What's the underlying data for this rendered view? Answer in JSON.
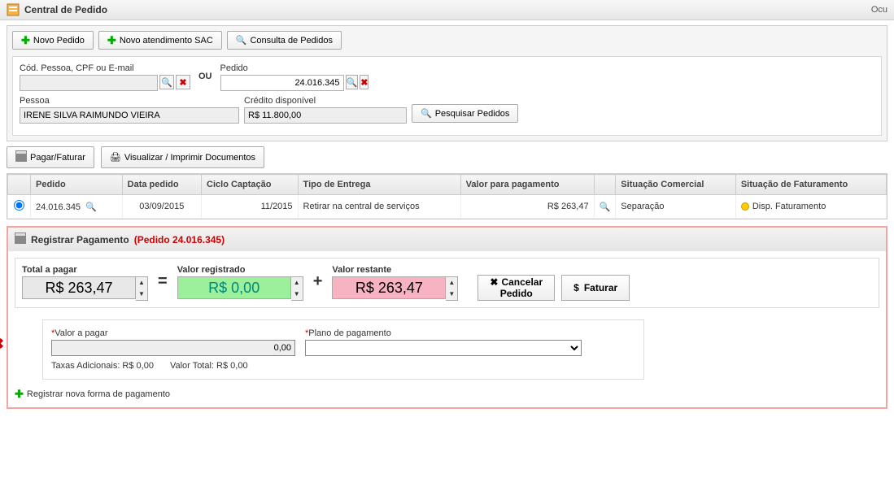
{
  "window": {
    "title": "Central de Pedido",
    "right_label": "Ocu"
  },
  "toolbar": {
    "new_order": "Novo Pedido",
    "new_sac": "Novo atendimento SAC",
    "consult": "Consulta de Pedidos"
  },
  "search": {
    "person_code_label": "Cód. Pessoa, CPF ou E-mail",
    "order_label": "Pedido",
    "order_value": "24.016.345",
    "ou": "OU",
    "person_label": "Pessoa",
    "person_value": "IRENE SILVA RAIMUNDO VIEIRA",
    "credit_label": "Crédito disponível",
    "credit_value": "R$ 11.800,00",
    "search_btn": "Pesquisar Pedidos"
  },
  "actions": {
    "pay": "Pagar/Faturar",
    "print": "Visualizar / Imprimir Documentos"
  },
  "table": {
    "headers": {
      "pedido": "Pedido",
      "data": "Data pedido",
      "ciclo": "Ciclo Captação",
      "tipo": "Tipo de Entrega",
      "valor_pag": "Valor para pagamento",
      "comercial": "Situação Comercial",
      "faturamento": "Situação de Faturamento"
    },
    "row": {
      "pedido": "24.016.345",
      "data": "03/09/2015",
      "ciclo": "11/2015",
      "tipo": "Retirar na central de serviços",
      "valor": "R$ 263,47",
      "comercial": "Separação",
      "faturamento": "Disp. Faturamento"
    }
  },
  "payment": {
    "title": "Registrar Pagamento",
    "sub": "(Pedido 24.016.345)",
    "total_label": "Total a pagar",
    "total_value": "R$ 263,47",
    "registered_label": "Valor registrado",
    "registered_value": "R$ 0,00",
    "remaining_label": "Valor restante",
    "remaining_value": "R$ 263,47",
    "cancel_btn_line1": "Cancelar",
    "cancel_btn_line2": "Pedido",
    "invoice_btn": "Faturar"
  },
  "form": {
    "valor_label": "Valor a pagar",
    "valor_value": "0,00",
    "plano_label": "Plano de pagamento",
    "extras_taxas": "Taxas Adicionais: R$ 0,00",
    "extras_total": "Valor Total: R$ 0,00"
  },
  "add_line": "Registrar nova forma de pagamento"
}
